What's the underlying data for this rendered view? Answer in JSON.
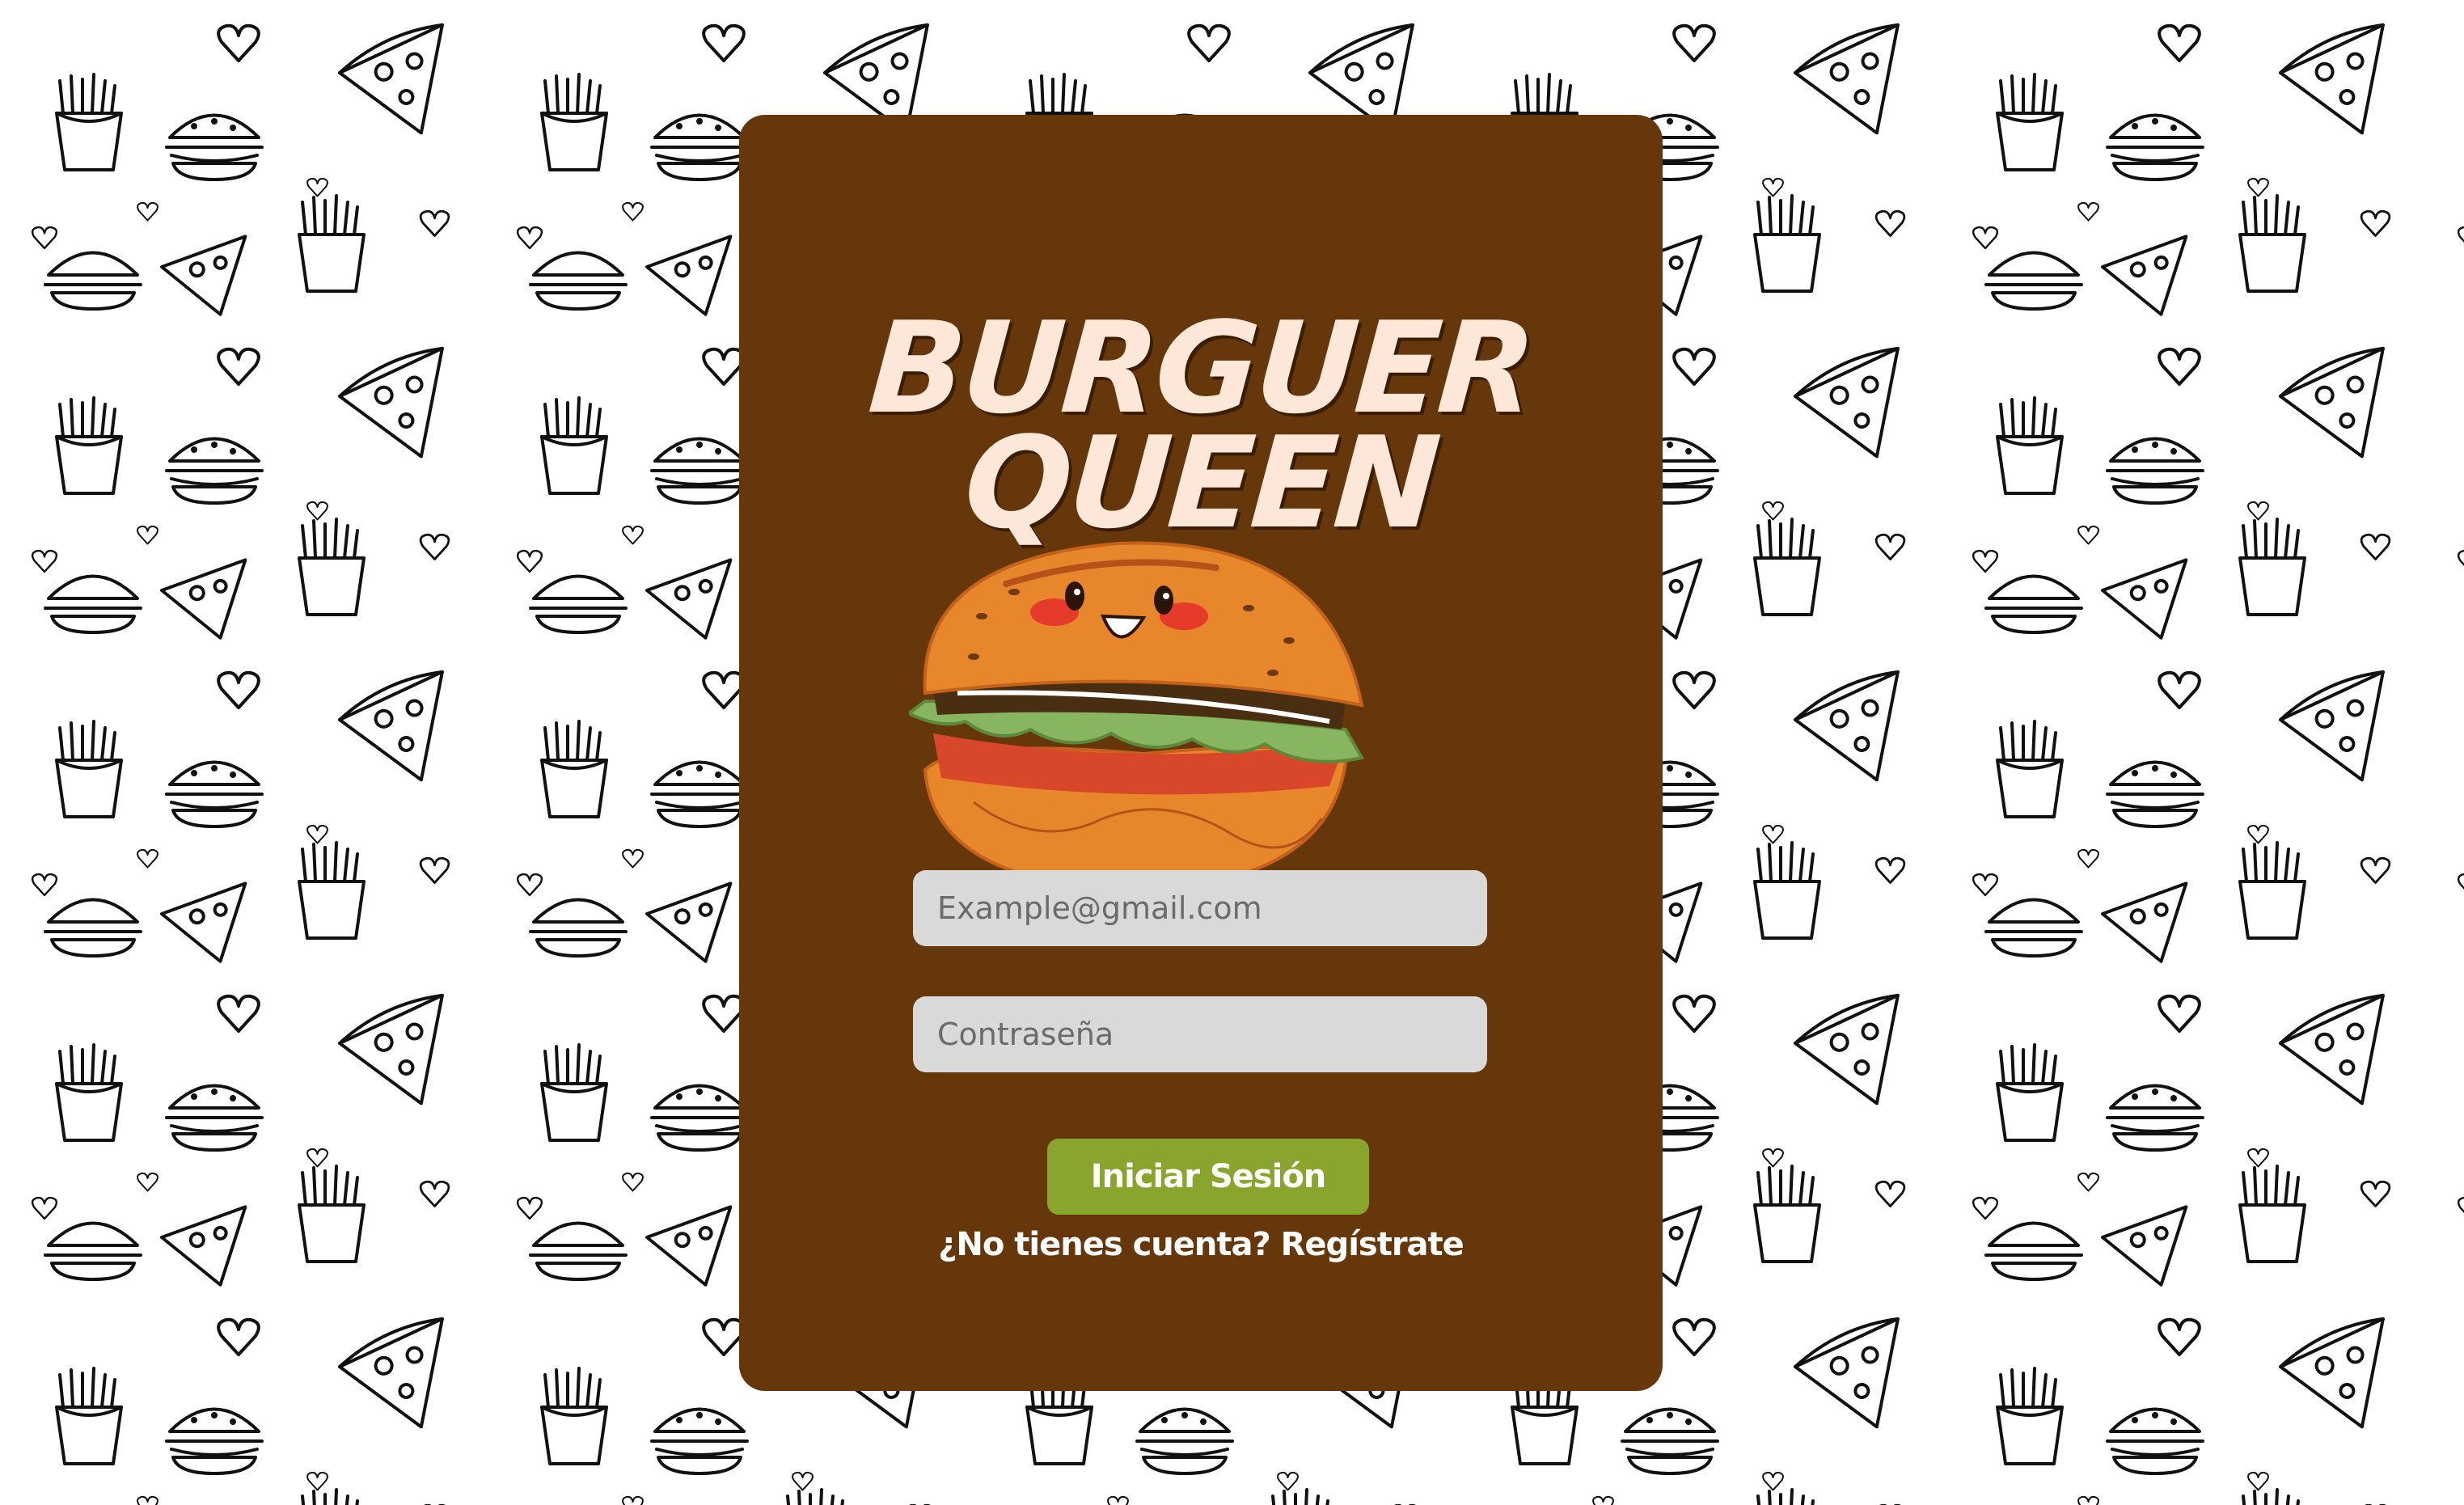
{
  "app": {
    "title": "Burguer Queen"
  },
  "logo": {
    "line1": "BURGUER",
    "line2": "QUEEN"
  },
  "login_form": {
    "email_placeholder": "Example@gmail.com",
    "email_value": "",
    "password_placeholder": "Contraseña",
    "password_value": "",
    "submit_label": "Iniciar Sesión",
    "register_prompt": "¿No tienes cuenta?",
    "register_link": "Regístrate"
  },
  "colors": {
    "card_background": "#66370b",
    "input_background": "#d9d9d9",
    "button_background": "#8aa52e",
    "logo_text": "#fde7d8",
    "page_background": "#ffffff"
  },
  "icons": {
    "background_pattern": [
      "fries-icon",
      "burger-icon",
      "pizza-slice-icon",
      "heart-icon"
    ],
    "mascot": "burger-mascot-icon"
  }
}
